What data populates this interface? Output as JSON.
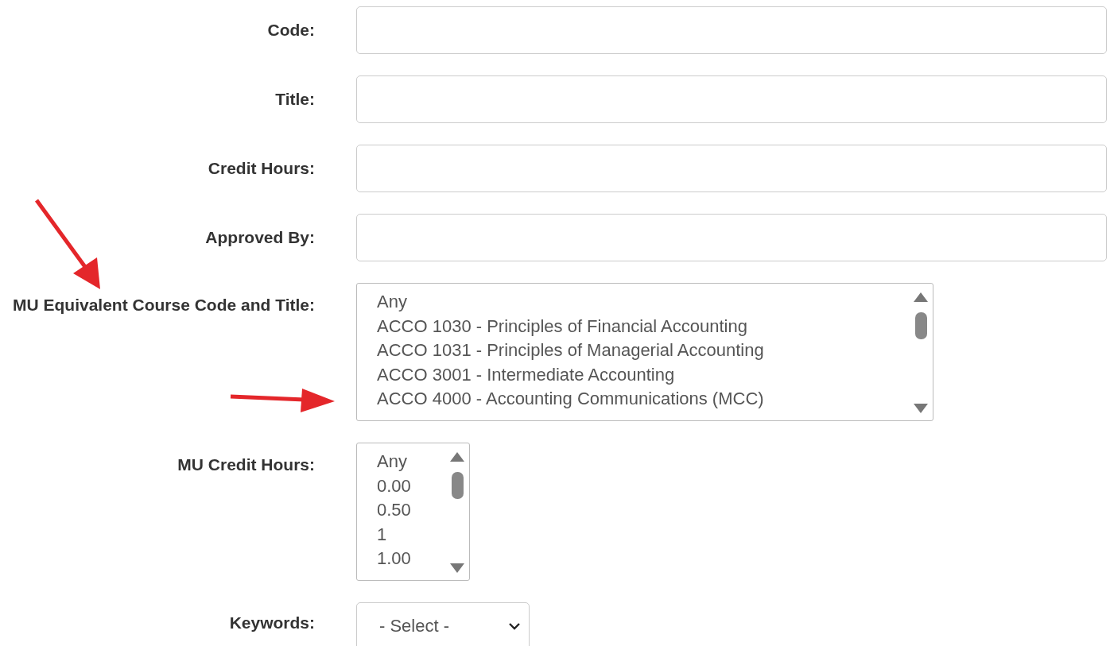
{
  "fields": [
    {
      "label": "Code:",
      "kind": "text"
    },
    {
      "label": "Title:",
      "kind": "text"
    },
    {
      "label": "Credit Hours:",
      "kind": "text"
    },
    {
      "label": "Approved By:",
      "kind": "text"
    },
    {
      "label": "MU Equivalent Course Code and Title:",
      "kind": "listbox",
      "options": [
        "Any",
        "ACCO 1030 - Principles of Financial Accounting",
        "ACCO 1031 - Principles of Managerial Accounting",
        "ACCO 3001 - Intermediate Accounting",
        "ACCO 4000 - Accounting Communications (MCC)"
      ]
    },
    {
      "label": "MU Credit Hours:",
      "kind": "listbox",
      "options": [
        "Any",
        "0.00",
        "0.50",
        "1",
        "1.00"
      ]
    },
    {
      "label": "Keywords:",
      "kind": "select",
      "value": "- Select -"
    }
  ]
}
